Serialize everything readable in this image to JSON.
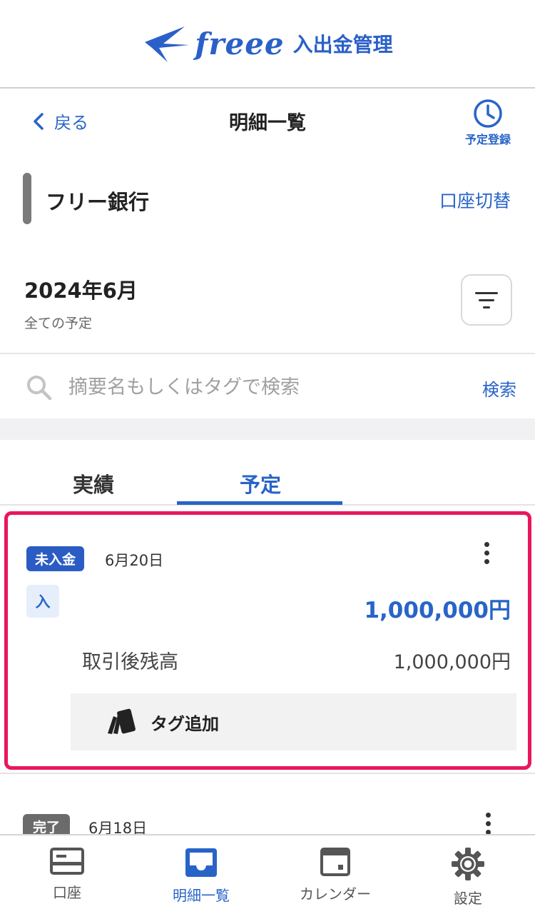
{
  "header": {
    "brand": "freee",
    "app_name": "入出金管理"
  },
  "navbar": {
    "back_label": "戻る",
    "title": "明細一覧",
    "schedule_label": "予定登録"
  },
  "account": {
    "bank_name": "フリー銀行",
    "switch_label": "口座切替"
  },
  "period": {
    "month": "2024年6月",
    "filter_label": "全ての予定"
  },
  "search": {
    "placeholder": "摘要名もしくはタグで検索",
    "button_label": "検索"
  },
  "tabs": [
    {
      "label": "実績",
      "active": false
    },
    {
      "label": "予定",
      "active": true
    }
  ],
  "entries": [
    {
      "status": "未入金",
      "date": "6月20日",
      "type": "入",
      "amount": "1,000,000円",
      "balance_label": "取引後残高",
      "balance": "1,000,000円",
      "tag_action": "タグ追加"
    },
    {
      "status": "完了",
      "date": "6月18日"
    }
  ],
  "tabbar": [
    {
      "label": "口座",
      "icon": "card-icon",
      "active": false
    },
    {
      "label": "明細一覧",
      "icon": "inbox-icon",
      "active": true
    },
    {
      "label": "カレンダー",
      "icon": "calendar-icon",
      "active": false
    },
    {
      "label": "設定",
      "icon": "gear-icon",
      "active": false
    }
  ],
  "colors": {
    "accent": "#2864c8",
    "highlight_border": "#e8175d",
    "unpaid_badge": "#2b5cc4",
    "done_badge": "#6b6b6b"
  }
}
